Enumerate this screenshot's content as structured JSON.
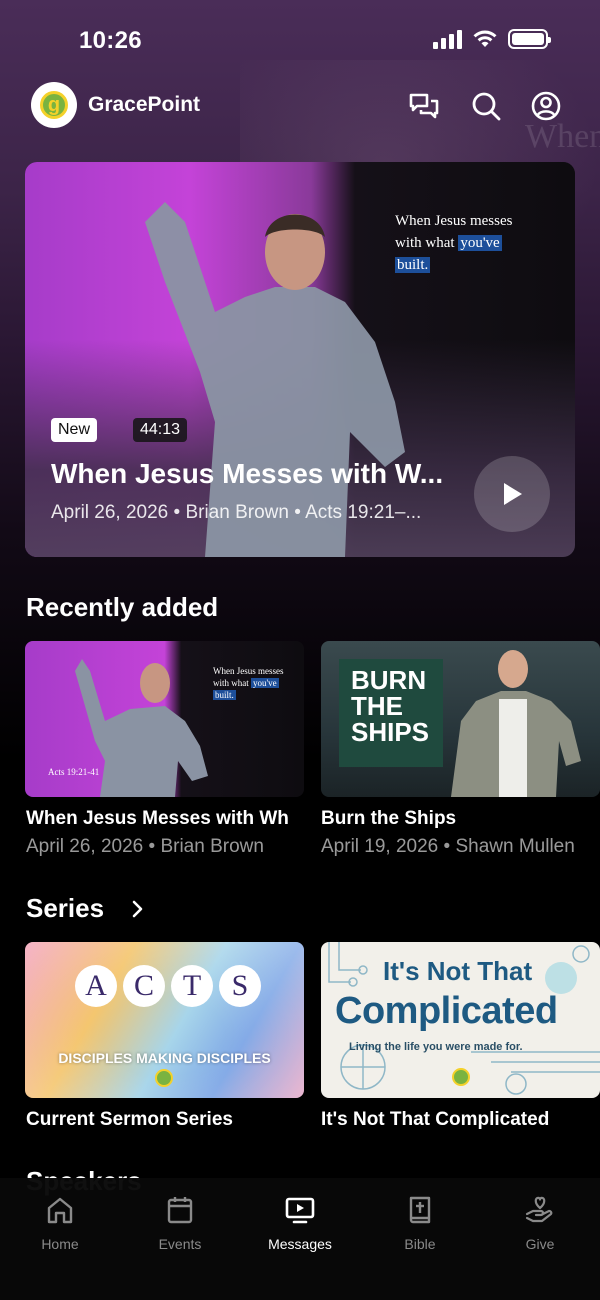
{
  "status_bar": {
    "time": "10:26"
  },
  "header": {
    "brand": "GracePoint",
    "logo_letter": "g"
  },
  "hero": {
    "badge": "New",
    "duration": "44:13",
    "title": "When Jesus Messes with W...",
    "meta": "April 26, 2026 • Brian Brown • Acts 19:21–...",
    "screen_text_1": "When Jesus messes",
    "screen_text_2": "with what ",
    "screen_text_3": "you've",
    "screen_text_4": "built."
  },
  "recently_added": {
    "title": "Recently added",
    "items": [
      {
        "title": "When Jesus Messes with Wh",
        "meta": "April 26, 2026 • Brian Brown",
        "overlay_1": "When Jesus messes",
        "overlay_2": "with what ",
        "overlay_3": "you've",
        "overlay_4": "built.",
        "reference": "Acts 19:21-41"
      },
      {
        "title": "Burn the Ships",
        "meta": "April 19, 2026 • Shawn Mullen",
        "art_1": "BURN",
        "art_2": "THE",
        "art_3": "SHIPS"
      }
    ]
  },
  "series": {
    "title": "Series",
    "items": [
      {
        "title": "Current Sermon Series",
        "art_letters": [
          "A",
          "C",
          "T",
          "S"
        ],
        "art_subtitle": "DISCIPLES MAKING DISCIPLES"
      },
      {
        "title": "It's Not That Complicated",
        "art_line_1": "It's Not That",
        "art_line_2": "Complicated",
        "art_tagline": "Living the life you were made for."
      }
    ]
  },
  "speakers": {
    "title": "Speakers"
  },
  "bottom_nav": {
    "items": [
      {
        "label": "Home",
        "icon": "home-icon"
      },
      {
        "label": "Events",
        "icon": "calendar-icon"
      },
      {
        "label": "Messages",
        "icon": "tv-icon",
        "active": true
      },
      {
        "label": "Bible",
        "icon": "bible-icon"
      },
      {
        "label": "Give",
        "icon": "give-icon"
      }
    ]
  }
}
